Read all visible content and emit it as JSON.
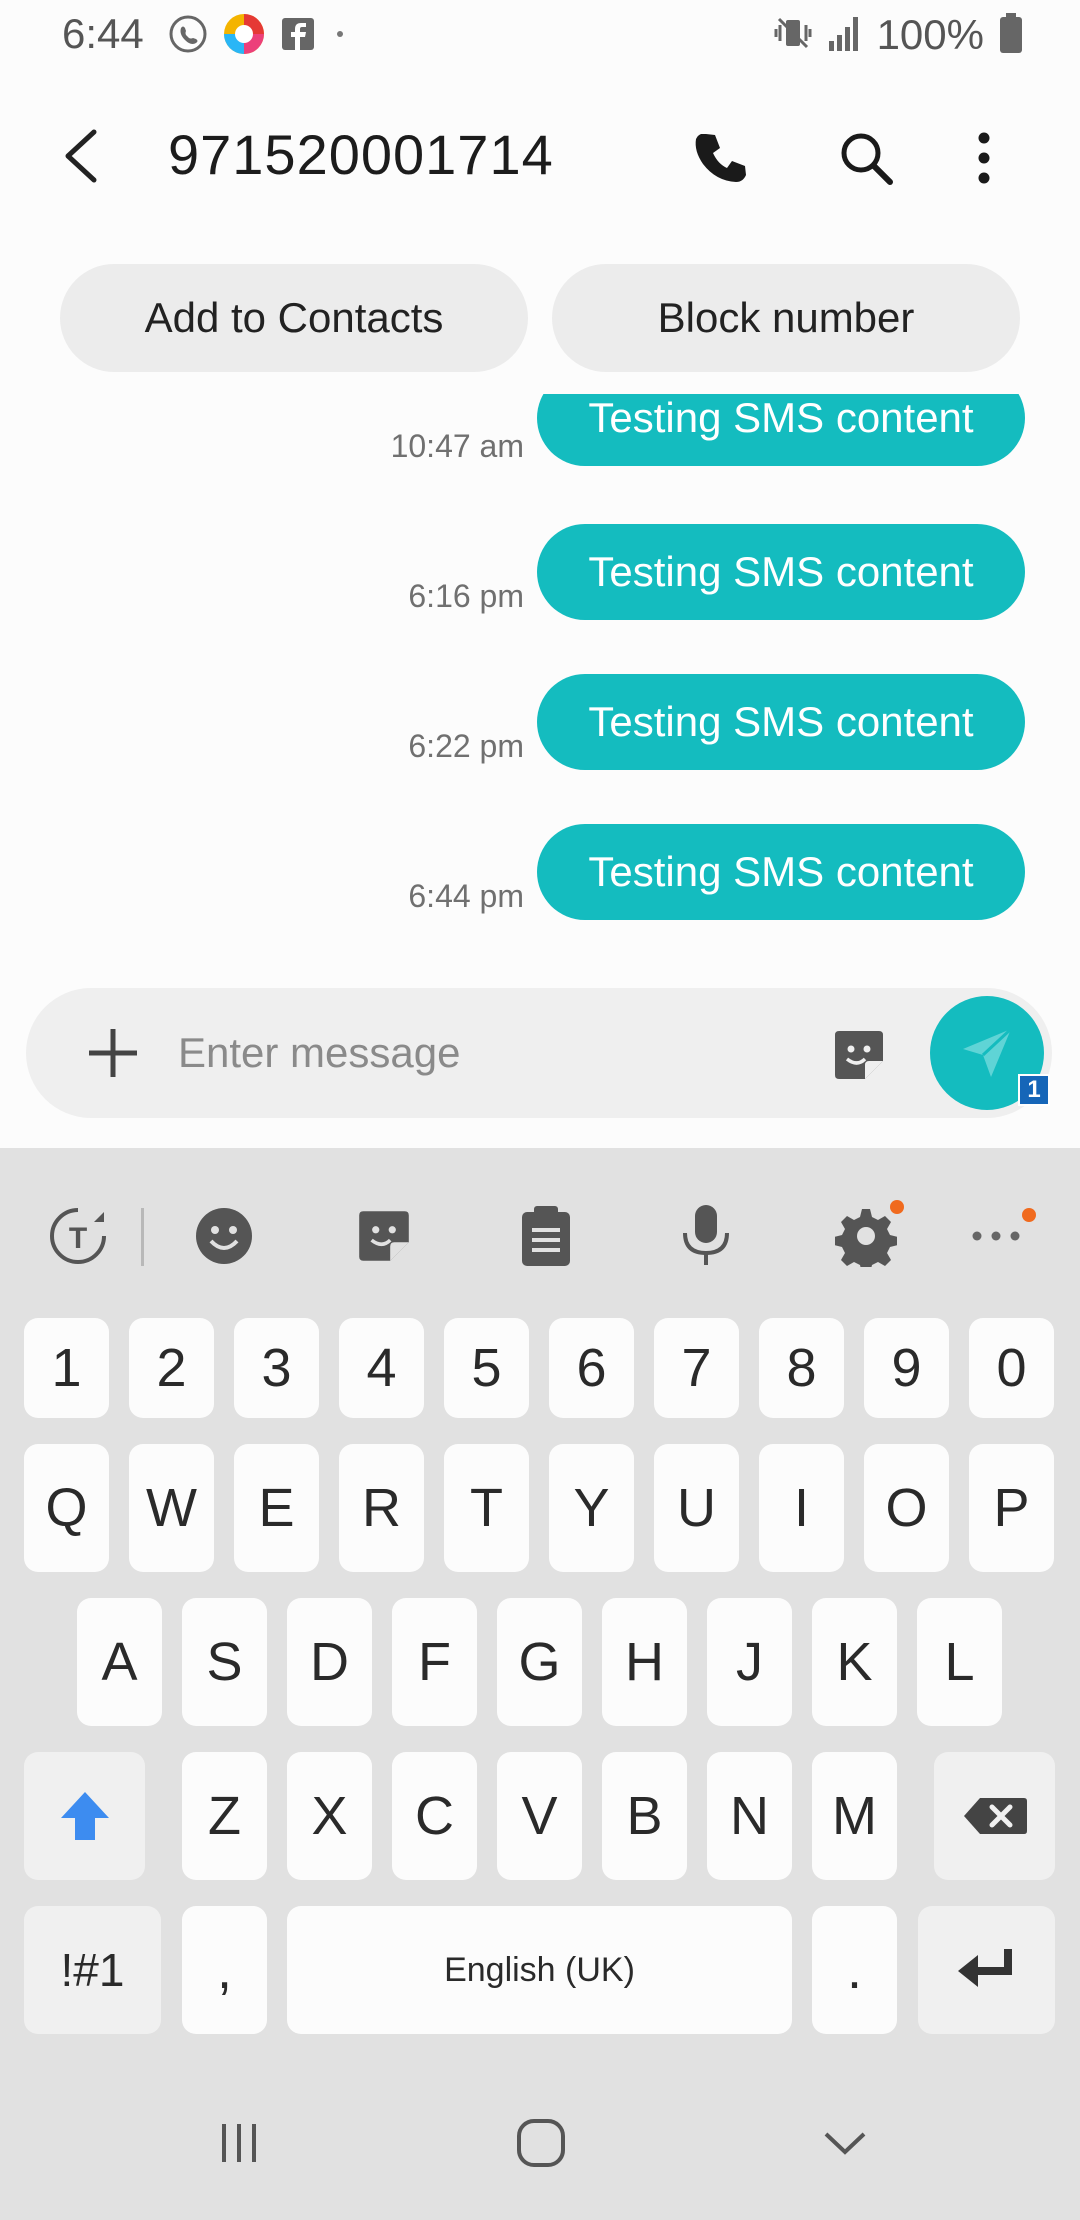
{
  "status_bar": {
    "time": "6:44",
    "battery": "100%",
    "left_icons": [
      "call-forward-icon",
      "browser-app-icon",
      "facebook-icon",
      "dot-icon"
    ],
    "right_icons": [
      "vibrate-icon",
      "signal-icon",
      "battery-icon"
    ]
  },
  "header": {
    "title": "971520001714",
    "actions": [
      "phone-icon",
      "search-icon",
      "more-icon"
    ]
  },
  "quick_actions": {
    "add_contacts": "Add to Contacts",
    "block_number": "Block number"
  },
  "messages": [
    {
      "text": "Testing SMS content",
      "time": "10:47 am"
    },
    {
      "text": "Testing SMS content",
      "time": "6:16 pm"
    },
    {
      "text": "Testing SMS content",
      "time": "6:22 pm"
    },
    {
      "text": "Testing SMS content",
      "time": "6:44 pm"
    }
  ],
  "compose": {
    "placeholder": "Enter message",
    "sim_badge": "1"
  },
  "keyboard": {
    "toolbar": [
      "translate-icon",
      "emoji-icon",
      "sticker-icon",
      "clipboard-icon",
      "mic-icon",
      "settings-icon",
      "more-icon"
    ],
    "row_numbers": [
      "1",
      "2",
      "3",
      "4",
      "5",
      "6",
      "7",
      "8",
      "9",
      "0"
    ],
    "row1": [
      "Q",
      "W",
      "E",
      "R",
      "T",
      "Y",
      "U",
      "I",
      "O",
      "P"
    ],
    "row2": [
      "A",
      "S",
      "D",
      "F",
      "G",
      "H",
      "J",
      "K",
      "L"
    ],
    "row3": [
      "Z",
      "X",
      "C",
      "V",
      "B",
      "N",
      "M"
    ],
    "symbols": "!#1",
    "comma": ",",
    "space": "English (UK)",
    "period": "."
  },
  "colors": {
    "accent": "#14bcbf",
    "keyboard_bg": "#e1e1e1",
    "notification_dot": "#f06a1e"
  }
}
